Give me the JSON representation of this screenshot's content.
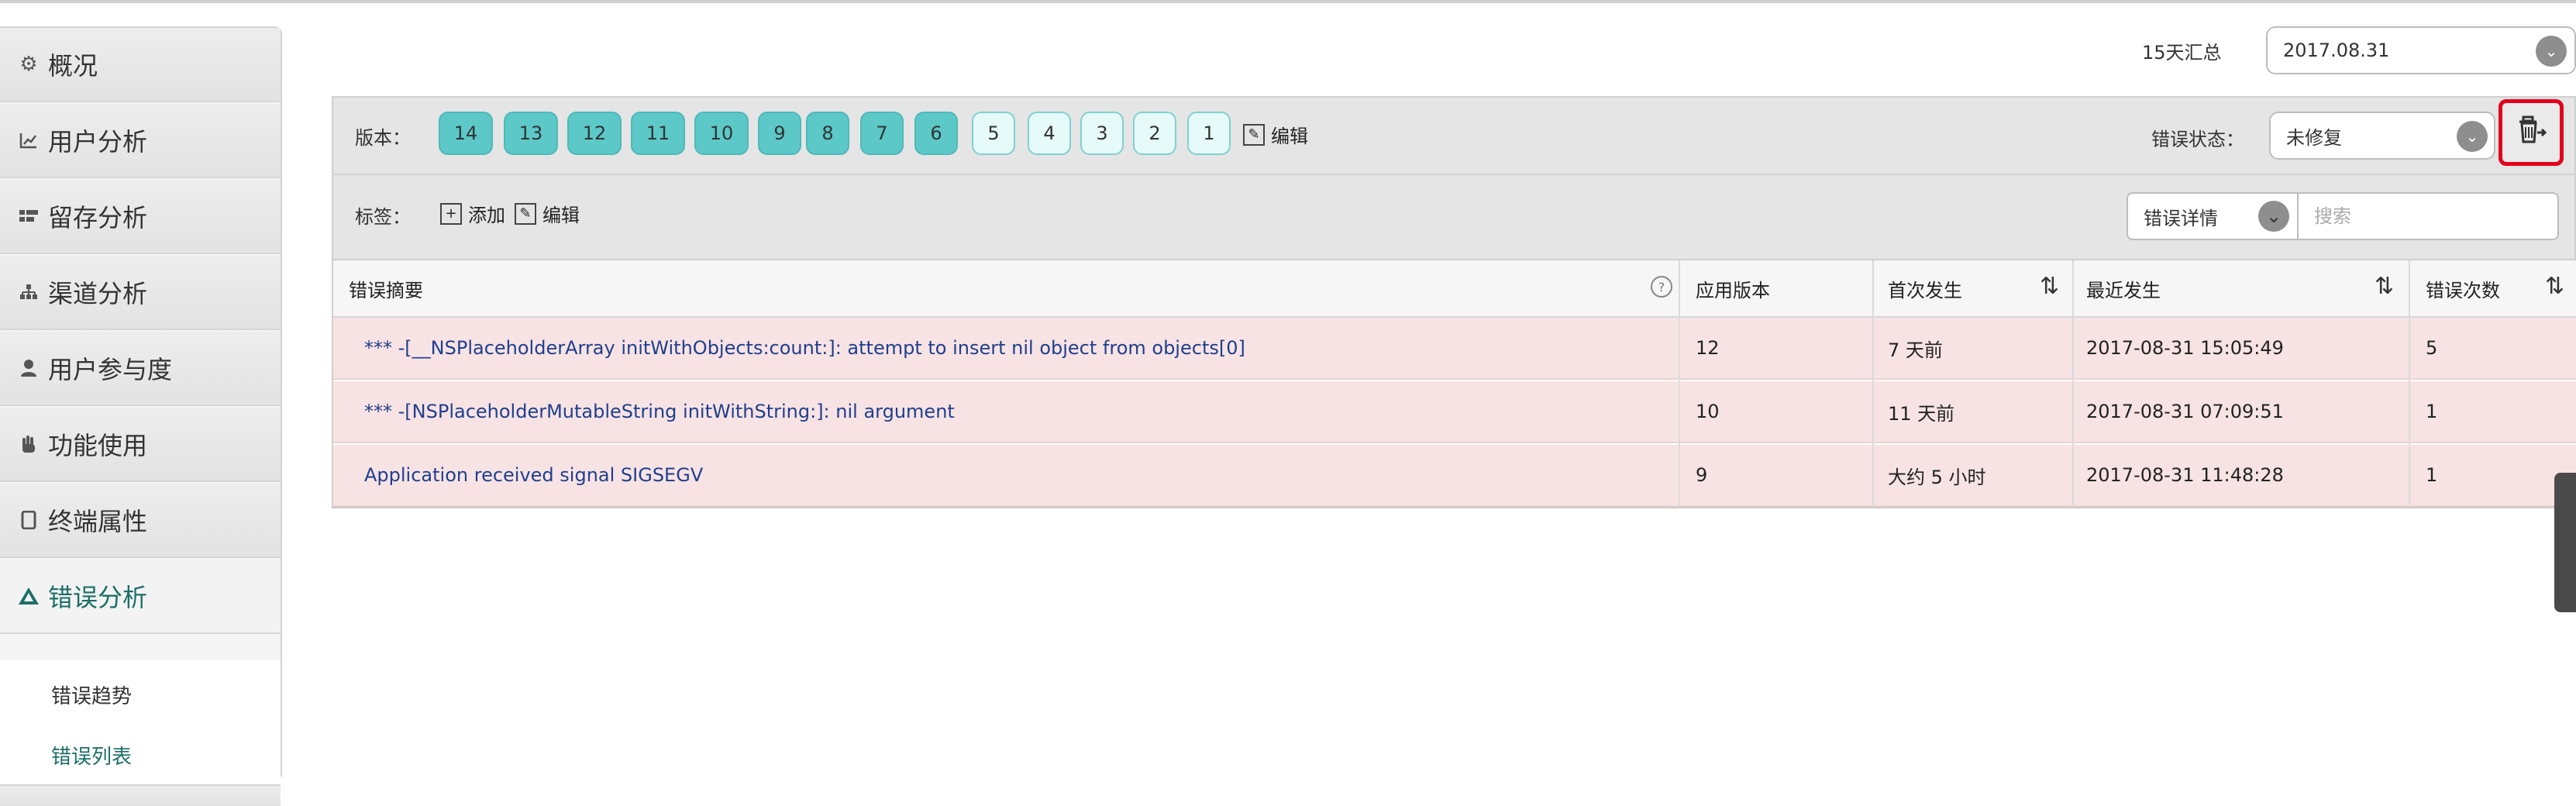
{
  "sidebar": {
    "items": [
      {
        "label": "概况",
        "icon": "gear-icon"
      },
      {
        "label": "用户分析",
        "icon": "chart-icon"
      },
      {
        "label": "留存分析",
        "icon": "grid-icon"
      },
      {
        "label": "渠道分析",
        "icon": "hierarchy-icon"
      },
      {
        "label": "用户参与度",
        "icon": "user-icon"
      },
      {
        "label": "功能使用",
        "icon": "hand-icon"
      },
      {
        "label": "终端属性",
        "icon": "tablet-icon"
      },
      {
        "label": "错误分析",
        "icon": "warning-icon"
      }
    ],
    "sub_items": [
      {
        "label": "错误趋势"
      },
      {
        "label": "错误列表"
      }
    ],
    "accent_color": "#1c6f66"
  },
  "header": {
    "summary_label": "15天汇总",
    "date_select": "2017.08.31"
  },
  "filter": {
    "version_label": "版本：",
    "versions": [
      "14",
      "13",
      "12",
      "11",
      "10",
      "9",
      "8",
      "7",
      "6",
      "5",
      "4",
      "3",
      "2",
      "1"
    ],
    "selected_versions": [
      "14",
      "13",
      "12",
      "11",
      "10",
      "9",
      "8",
      "7",
      "6"
    ],
    "edit_label": "编辑",
    "status_label": "错误状态：",
    "status_value": "未修复",
    "tag_label": "标签：",
    "add_label": "添加",
    "tag_edit_label": "编辑",
    "detail_select": "错误详情",
    "search_placeholder": "搜索"
  },
  "table": {
    "columns": [
      "错误摘要",
      "应用版本",
      "首次发生",
      "最近发生",
      "错误次数"
    ],
    "rows": [
      {
        "summary": "*** -[__NSPlaceholderArray initWithObjects:count:]: attempt to insert nil object from objects[0]",
        "version": "12",
        "first": "7 天前",
        "last": "2017-08-31 15:05:49",
        "count": "5"
      },
      {
        "summary": "*** -[NSPlaceholderMutableString initWithString:]: nil argument",
        "version": "10",
        "first": "11 天前",
        "last": "2017-08-31 07:09:51",
        "count": "1"
      },
      {
        "summary": "Application received signal SIGSEGV",
        "version": "9",
        "first": "大约 5 小时",
        "last": "2017-08-31 11:48:28",
        "count": "1"
      }
    ]
  }
}
